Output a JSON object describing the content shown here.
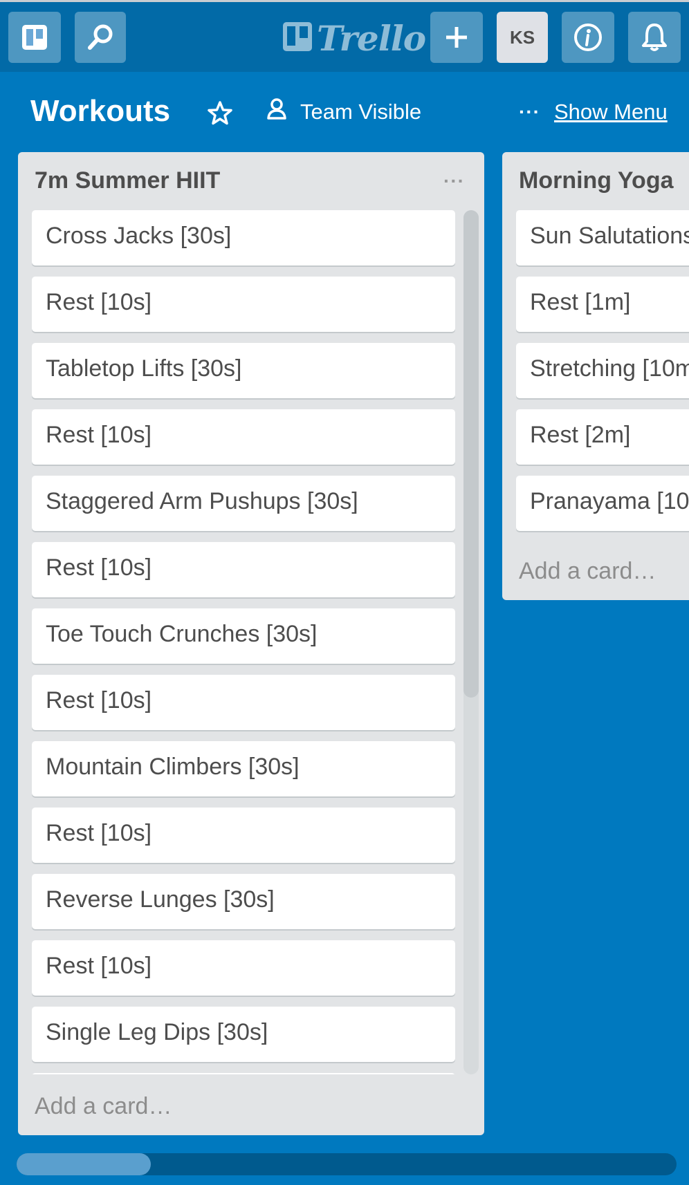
{
  "header": {
    "logo_text": "Trello",
    "avatar_initials": "KS"
  },
  "board": {
    "title": "Workouts",
    "visibility": "Team Visible",
    "menu_dots": "···",
    "show_menu": "Show Menu"
  },
  "lists": [
    {
      "title": "7m Summer HIIT",
      "more": "···",
      "cards": [
        "Cross Jacks [30s]",
        "Rest [10s]",
        "Tabletop Lifts [30s]",
        "Rest [10s]",
        "Staggered Arm Pushups [30s]",
        "Rest [10s]",
        "Toe Touch Crunches [30s]",
        "Rest [10s]",
        "Mountain Climbers [30s]",
        "Rest [10s]",
        "Reverse Lunges [30s]",
        "Rest [10s]",
        "Single Leg Dips [30s]"
      ],
      "add_card": "Add a card…"
    },
    {
      "title": "Morning Yoga",
      "cards": [
        "Sun Salutations",
        "Rest [1m]",
        "Stretching [10m",
        "Rest [2m]",
        "Pranayama [10"
      ],
      "add_card": "Add a card…"
    }
  ],
  "colors": {
    "board_bg": "#0079bf",
    "header_bg": "#026aa7",
    "list_bg": "#e2e4e6"
  }
}
